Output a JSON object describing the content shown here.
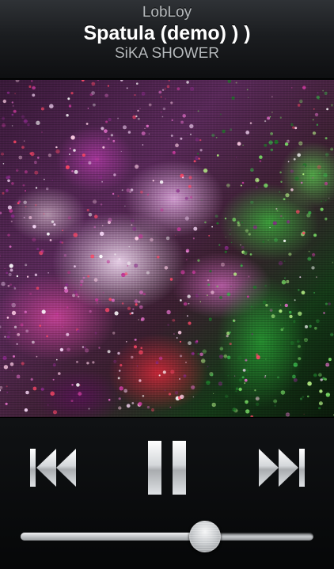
{
  "now_playing": {
    "artist": "LobLoy",
    "title": "Spatula (demo) ) )",
    "album": "SiKA SHOWER"
  },
  "controls": {
    "previous_icon": "previous-track-icon",
    "pause_icon": "pause-icon",
    "next_icon": "next-track-icon"
  },
  "volume": {
    "level": 0.63
  },
  "colors": {
    "header_text_primary": "#ffffff",
    "header_text_secondary": "#b6babd",
    "background": "#050607",
    "control_silver": "#d9dcdf"
  }
}
